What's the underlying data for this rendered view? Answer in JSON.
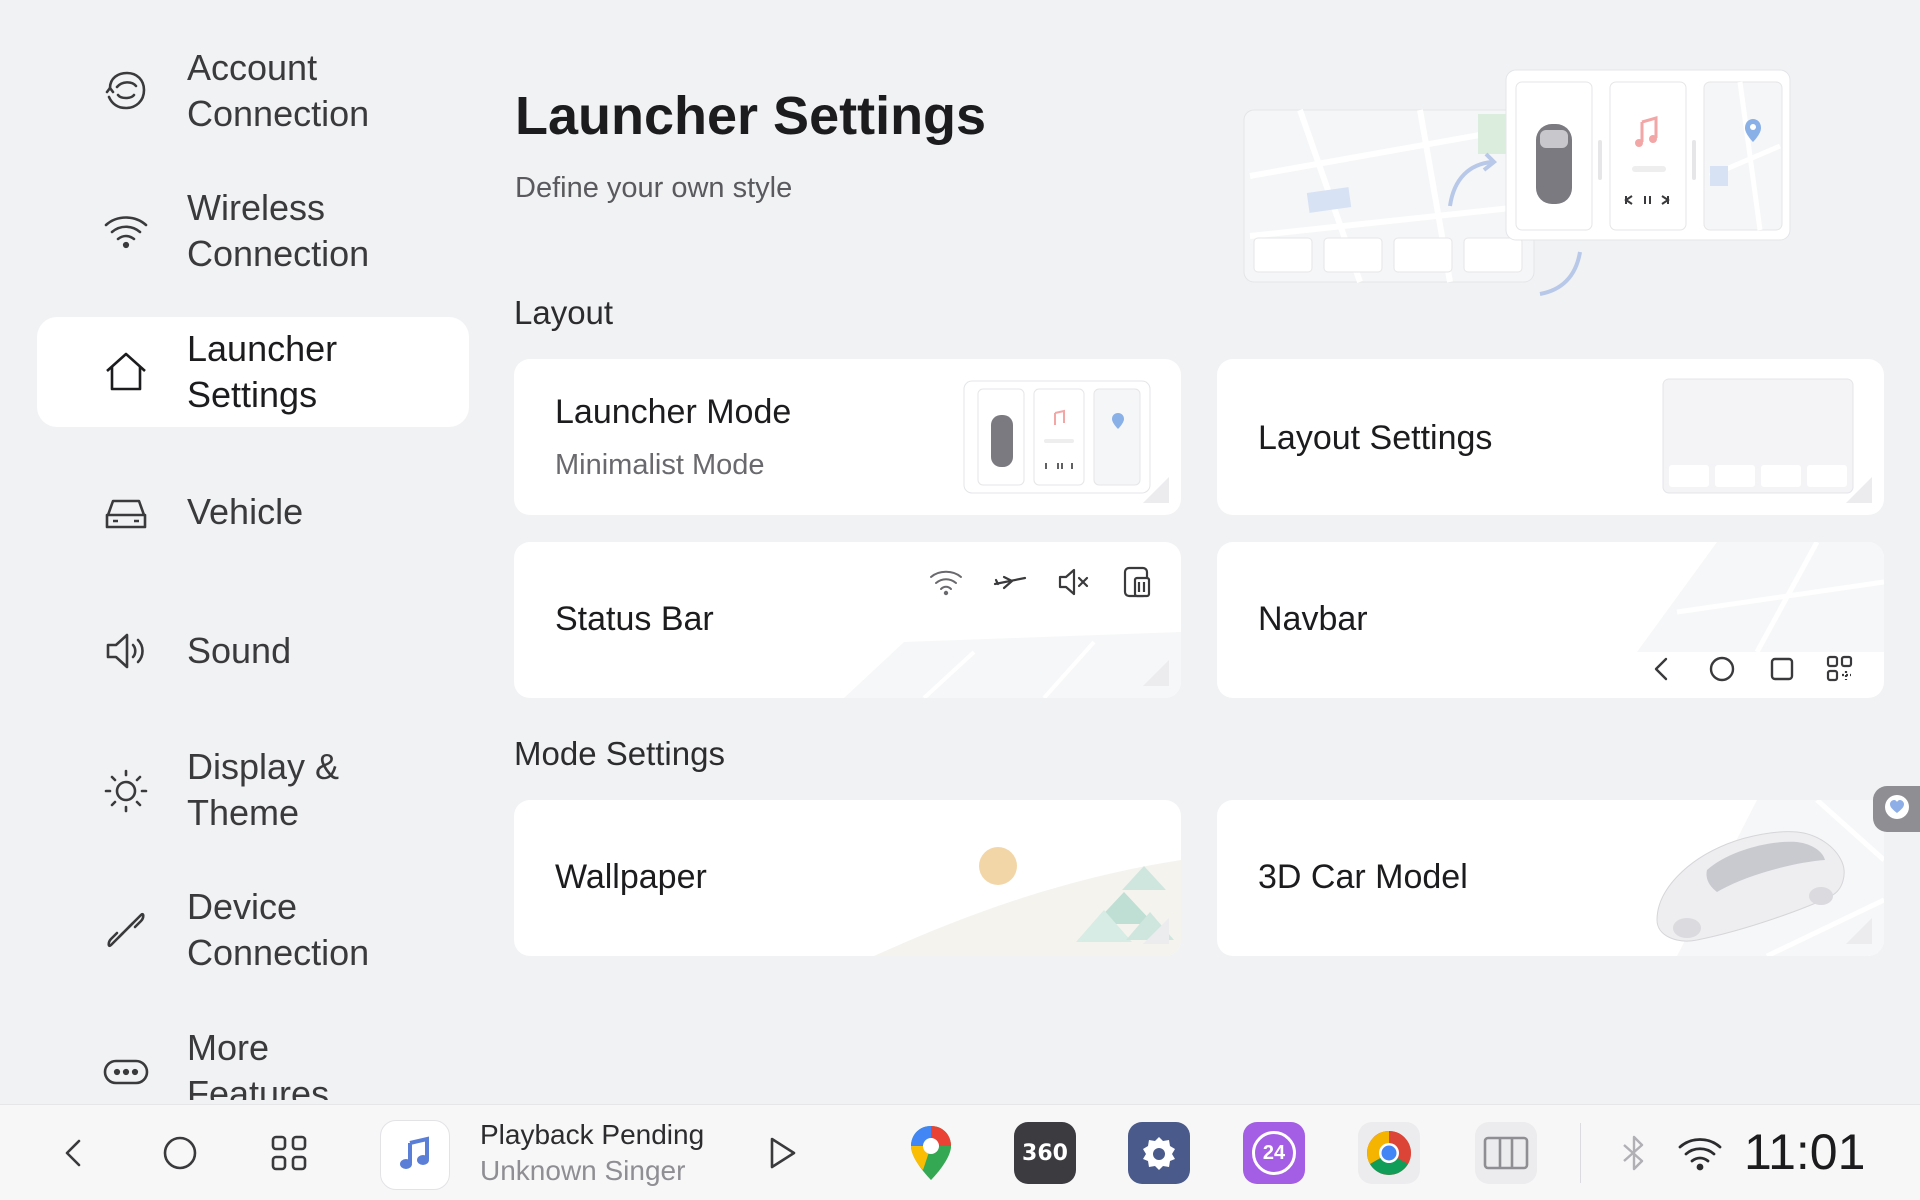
{
  "sidebar": {
    "items": [
      {
        "label": "Account\nConnection",
        "icon": "account-icon"
      },
      {
        "label": "Wireless\nConnection",
        "icon": "wifi-icon"
      },
      {
        "label": "Launcher\nSettings",
        "icon": "home-icon",
        "active": true
      },
      {
        "label": "Vehicle",
        "icon": "vehicle-icon"
      },
      {
        "label": "Sound",
        "icon": "speaker-icon"
      },
      {
        "label": "Display &\nTheme",
        "icon": "sun-icon"
      },
      {
        "label": "Device\nConnection",
        "icon": "link-icon"
      },
      {
        "label": "More\nFeatures",
        "icon": "more-icon"
      }
    ]
  },
  "main": {
    "title": "Launcher Settings",
    "subtitle": "Define your own style",
    "sections": {
      "layout": "Layout",
      "mode": "Mode Settings"
    },
    "cards": {
      "launcher_mode": {
        "title": "Launcher Mode",
        "value": "Minimalist Mode"
      },
      "layout_settings": {
        "title": "Layout Settings"
      },
      "status_bar": {
        "title": "Status Bar"
      },
      "navbar": {
        "title": "Navbar"
      },
      "wallpaper": {
        "title": "Wallpaper"
      },
      "car_model": {
        "title": "3D Car Model"
      }
    }
  },
  "dock": {
    "track_title": "Playback Pending",
    "track_artist": "Unknown Singer",
    "app_360_label": "360",
    "app_24_label": "24",
    "time": "11:01"
  },
  "colors": {
    "background": "#f1f2f4",
    "card": "#ffffff",
    "settings_app": "#4a5a8a",
    "clock24_app": "#a45ee6",
    "app360": "#3c3c40"
  }
}
